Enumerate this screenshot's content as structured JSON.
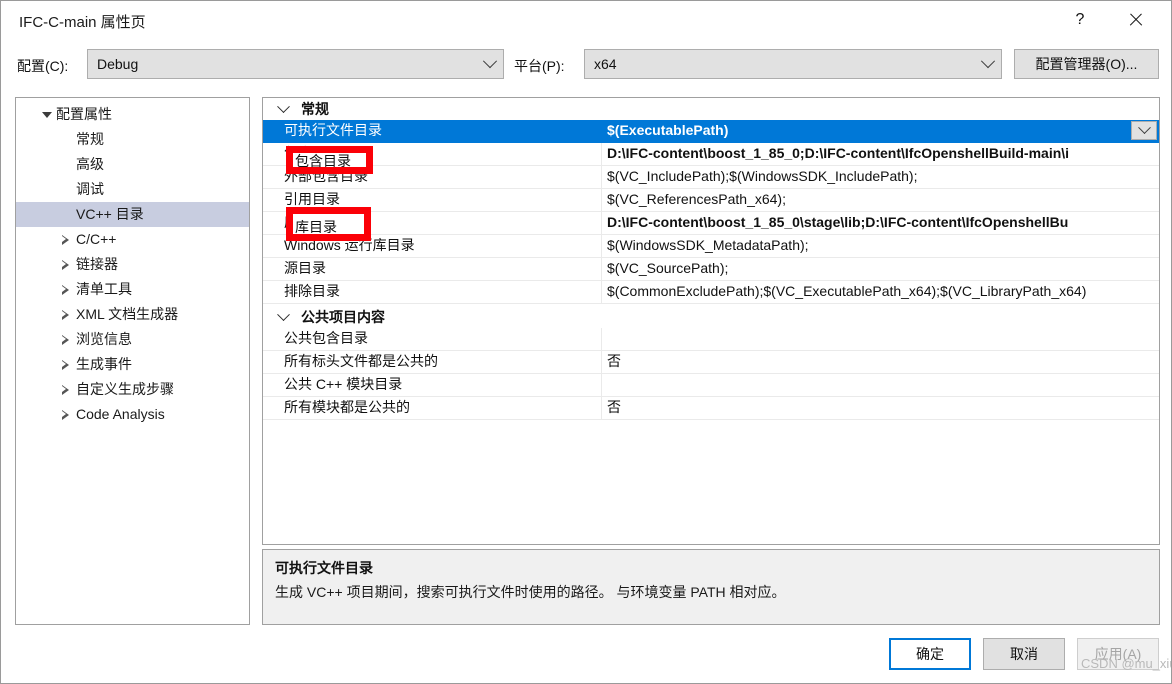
{
  "window": {
    "title": "IFC-C-main 属性页",
    "help_label": "?",
    "close_label": "✕"
  },
  "config_bar": {
    "configuration_label": "配置(C):",
    "configuration_value": "Debug",
    "platform_label": "平台(P):",
    "platform_value": "x64",
    "config_manager_button": "配置管理器(O)..."
  },
  "tree": {
    "items": [
      {
        "label": "配置属性",
        "depth": 0,
        "expander": "expanded",
        "selected": false
      },
      {
        "label": "常规",
        "depth": 1,
        "expander": "none",
        "selected": false
      },
      {
        "label": "高级",
        "depth": 1,
        "expander": "none",
        "selected": false
      },
      {
        "label": "调试",
        "depth": 1,
        "expander": "none",
        "selected": false
      },
      {
        "label": "VC++ 目录",
        "depth": 1,
        "expander": "none",
        "selected": true
      },
      {
        "label": "C/C++",
        "depth": 1,
        "expander": "collapsed",
        "selected": false
      },
      {
        "label": "链接器",
        "depth": 1,
        "expander": "collapsed",
        "selected": false
      },
      {
        "label": "清单工具",
        "depth": 1,
        "expander": "collapsed",
        "selected": false
      },
      {
        "label": "XML 文档生成器",
        "depth": 1,
        "expander": "collapsed",
        "selected": false
      },
      {
        "label": "浏览信息",
        "depth": 1,
        "expander": "collapsed",
        "selected": false
      },
      {
        "label": "生成事件",
        "depth": 1,
        "expander": "collapsed",
        "selected": false
      },
      {
        "label": "自定义生成步骤",
        "depth": 1,
        "expander": "collapsed",
        "selected": false
      },
      {
        "label": "Code Analysis",
        "depth": 1,
        "expander": "collapsed",
        "selected": false
      }
    ]
  },
  "grid": {
    "sections": [
      {
        "title": "常规",
        "expanded": true,
        "rows": [
          {
            "name": "可执行文件目录",
            "value": "$(ExecutablePath)",
            "selected": true,
            "bold": true,
            "has_dropdown": true
          },
          {
            "name": "包含目录",
            "value": "D:\\IFC-content\\boost_1_85_0;D:\\IFC-content\\IfcOpenshellBuild-main\\i",
            "selected": false,
            "bold": true,
            "has_dropdown": false
          },
          {
            "name": "外部包含目录",
            "value": "$(VC_IncludePath);$(WindowsSDK_IncludePath);",
            "selected": false,
            "bold": false,
            "has_dropdown": false
          },
          {
            "name": "引用目录",
            "value": "$(VC_ReferencesPath_x64);",
            "selected": false,
            "bold": false,
            "has_dropdown": false
          },
          {
            "name": "库目录",
            "value": "D:\\IFC-content\\boost_1_85_0\\stage\\lib;D:\\IFC-content\\IfcOpenshellBu",
            "selected": false,
            "bold": true,
            "has_dropdown": false
          },
          {
            "name": "Windows 运行库目录",
            "value": "$(WindowsSDK_MetadataPath);",
            "selected": false,
            "bold": false,
            "has_dropdown": false
          },
          {
            "name": "源目录",
            "value": "$(VC_SourcePath);",
            "selected": false,
            "bold": false,
            "has_dropdown": false
          },
          {
            "name": "排除目录",
            "value": "$(CommonExcludePath);$(VC_ExecutablePath_x64);$(VC_LibraryPath_x64)",
            "selected": false,
            "bold": false,
            "has_dropdown": false
          }
        ]
      },
      {
        "title": "公共项目内容",
        "expanded": true,
        "rows": [
          {
            "name": "公共包含目录",
            "value": "",
            "selected": false,
            "bold": false,
            "has_dropdown": false
          },
          {
            "name": "所有标头文件都是公共的",
            "value": "否",
            "selected": false,
            "bold": false,
            "has_dropdown": false
          },
          {
            "name": "公共 C++ 模块目录",
            "value": "",
            "selected": false,
            "bold": false,
            "has_dropdown": false
          },
          {
            "name": "所有模块都是公共的",
            "value": "否",
            "selected": false,
            "bold": false,
            "has_dropdown": false
          }
        ]
      }
    ]
  },
  "description": {
    "title": "可执行文件目录",
    "body": "生成 VC++ 项目期间，搜索可执行文件时使用的路径。 与环境变量 PATH 相对应。"
  },
  "footer": {
    "ok_label": "确定",
    "cancel_label": "取消",
    "apply_label": "应用(A)"
  },
  "annotations": [
    {
      "text": "包含目录"
    },
    {
      "text": "库目录"
    }
  ],
  "watermark": "CSDN @mu_xiu",
  "colors": {
    "selection_blue": "#0078d7",
    "annotation_red": "#fb0007",
    "tree_selection": "#c8cde0"
  }
}
